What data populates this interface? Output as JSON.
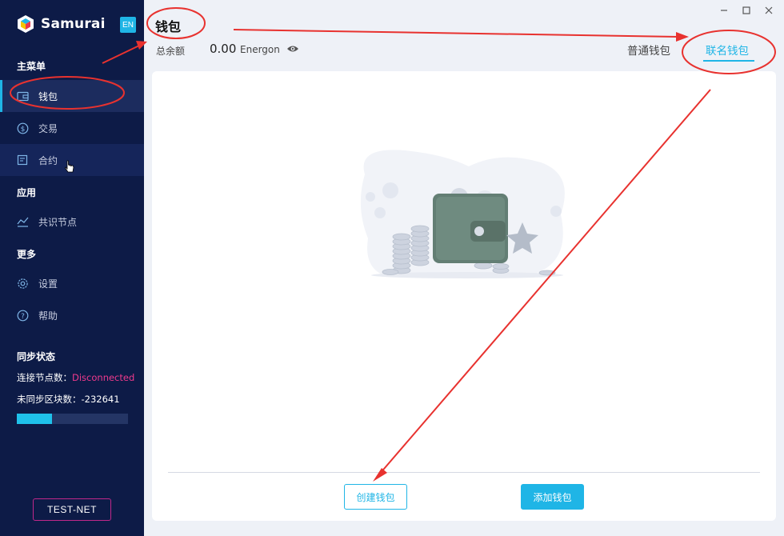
{
  "app": {
    "name": "Samurai",
    "lang_button": "EN"
  },
  "sidebar": {
    "main_menu_title": "主菜单",
    "items": [
      {
        "label": "钱包",
        "icon": "wallet-icon"
      },
      {
        "label": "交易",
        "icon": "dollar-circle-icon"
      },
      {
        "label": "合约",
        "icon": "contract-icon"
      }
    ],
    "apps_title": "应用",
    "app_items": [
      {
        "label": "共识节点",
        "icon": "node-icon"
      }
    ],
    "more_title": "更多",
    "more_items": [
      {
        "label": "设置",
        "icon": "gear-icon"
      },
      {
        "label": "帮助",
        "icon": "help-icon"
      }
    ],
    "sync": {
      "title": "同步状态",
      "nodes_label": "连接节点数：",
      "nodes_value": "Disconnected",
      "unsynced_label": "未同步区块数：",
      "unsynced_value": "-232641",
      "progress_fraction": 0.32
    },
    "network_badge": "TEST-NET"
  },
  "header": {
    "title": "钱包",
    "balance_label": "总余额",
    "balance_value": "0.00",
    "balance_unit": "Energon",
    "tabs": [
      {
        "label": "普通钱包",
        "active": false
      },
      {
        "label": "联名钱包",
        "active": true
      }
    ]
  },
  "main": {
    "create_button": "创建钱包",
    "add_button": "添加钱包"
  },
  "colors": {
    "sidebar_bg": "#0d1b47",
    "accent": "#1fb5e6",
    "error": "#ee3a8c",
    "annotation": "#e8322f"
  }
}
